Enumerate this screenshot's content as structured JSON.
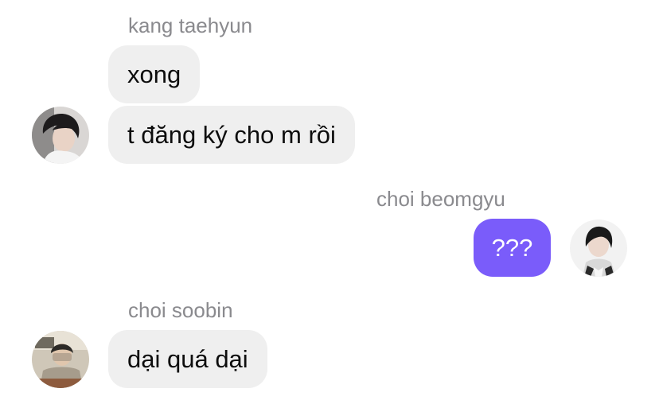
{
  "messages": [
    {
      "sender": "kang taehyun",
      "bubbles": [
        "xong",
        "t đăng ký cho m rồi"
      ],
      "is_me": false
    },
    {
      "sender": "choi beomgyu",
      "bubbles": [
        "???"
      ],
      "is_me": true
    },
    {
      "sender": "choi soobin",
      "bubbles": [
        "dại quá dại"
      ],
      "is_me": false
    }
  ],
  "colors": {
    "incoming_bubble": "#efefef",
    "outgoing_bubble": "#7a5cfa",
    "sender_name": "#8a8a8e"
  },
  "icons": {
    "avatar_1": "avatar-photo-icon",
    "avatar_2": "avatar-photo-icon",
    "avatar_3": "avatar-photo-icon"
  }
}
